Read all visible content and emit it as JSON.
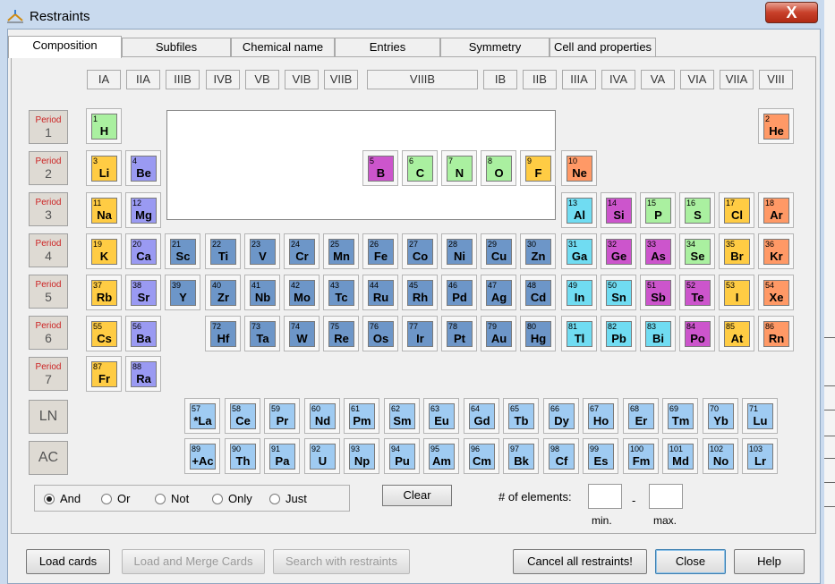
{
  "window": {
    "title": "Restraints",
    "close_glyph": "X"
  },
  "tabs": [
    {
      "label": "Composition",
      "active": true
    },
    {
      "label": "Subfiles",
      "active": false
    },
    {
      "label": "Chemical name",
      "active": false
    },
    {
      "label": "Entries",
      "active": false
    },
    {
      "label": "Symmetry",
      "active": false
    },
    {
      "label": "Cell and properties",
      "active": false
    }
  ],
  "groups": [
    "IA",
    "IIA",
    "IIIB",
    "IVB",
    "VB",
    "VIB",
    "VIIB",
    "VIIIB",
    "IB",
    "IIB",
    "IIIA",
    "IVA",
    "VA",
    "VIA",
    "VIIA",
    "VIII"
  ],
  "periods": [
    {
      "label": "Period",
      "num": "1"
    },
    {
      "label": "Period",
      "num": "2"
    },
    {
      "label": "Period",
      "num": "3"
    },
    {
      "label": "Period",
      "num": "4"
    },
    {
      "label": "Period",
      "num": "5"
    },
    {
      "label": "Period",
      "num": "6"
    },
    {
      "label": "Period",
      "num": "7"
    }
  ],
  "series_buttons": {
    "ln": "LN",
    "ac": "AC"
  },
  "colors": {
    "nonmetal": "#aaf0a0",
    "alkali": "#ffcc44",
    "alkaline": "#9a9af2",
    "transition": "#6d96c8",
    "poor": "#70dcf2",
    "metalloid": "#cc55cc",
    "halogen": "#ffcc44",
    "noble": "#ff9966",
    "rare": "#9fcbf2"
  },
  "elements": [
    {
      "num": "1",
      "sym": "H"
    },
    {
      "num": "2",
      "sym": "He"
    },
    {
      "num": "3",
      "sym": "Li"
    },
    {
      "num": "4",
      "sym": "Be"
    },
    {
      "num": "5",
      "sym": "B"
    },
    {
      "num": "6",
      "sym": "C"
    },
    {
      "num": "7",
      "sym": "N"
    },
    {
      "num": "8",
      "sym": "O"
    },
    {
      "num": "9",
      "sym": "F"
    },
    {
      "num": "10",
      "sym": "Ne"
    },
    {
      "num": "11",
      "sym": "Na"
    },
    {
      "num": "12",
      "sym": "Mg"
    },
    {
      "num": "13",
      "sym": "Al"
    },
    {
      "num": "14",
      "sym": "Si"
    },
    {
      "num": "15",
      "sym": "P"
    },
    {
      "num": "16",
      "sym": "S"
    },
    {
      "num": "17",
      "sym": "Cl"
    },
    {
      "num": "18",
      "sym": "Ar"
    },
    {
      "num": "19",
      "sym": "K"
    },
    {
      "num": "20",
      "sym": "Ca"
    },
    {
      "num": "21",
      "sym": "Sc"
    },
    {
      "num": "22",
      "sym": "Ti"
    },
    {
      "num": "23",
      "sym": "V"
    },
    {
      "num": "24",
      "sym": "Cr"
    },
    {
      "num": "25",
      "sym": "Mn"
    },
    {
      "num": "26",
      "sym": "Fe"
    },
    {
      "num": "27",
      "sym": "Co"
    },
    {
      "num": "28",
      "sym": "Ni"
    },
    {
      "num": "29",
      "sym": "Cu"
    },
    {
      "num": "30",
      "sym": "Zn"
    },
    {
      "num": "31",
      "sym": "Ga"
    },
    {
      "num": "32",
      "sym": "Ge"
    },
    {
      "num": "33",
      "sym": "As"
    },
    {
      "num": "34",
      "sym": "Se"
    },
    {
      "num": "35",
      "sym": "Br"
    },
    {
      "num": "36",
      "sym": "Kr"
    },
    {
      "num": "37",
      "sym": "Rb"
    },
    {
      "num": "38",
      "sym": "Sr"
    },
    {
      "num": "39",
      "sym": "Y"
    },
    {
      "num": "40",
      "sym": "Zr"
    },
    {
      "num": "41",
      "sym": "Nb"
    },
    {
      "num": "42",
      "sym": "Mo"
    },
    {
      "num": "43",
      "sym": "Tc"
    },
    {
      "num": "44",
      "sym": "Ru"
    },
    {
      "num": "45",
      "sym": "Rh"
    },
    {
      "num": "46",
      "sym": "Pd"
    },
    {
      "num": "47",
      "sym": "Ag"
    },
    {
      "num": "48",
      "sym": "Cd"
    },
    {
      "num": "49",
      "sym": "In"
    },
    {
      "num": "50",
      "sym": "Sn"
    },
    {
      "num": "51",
      "sym": "Sb"
    },
    {
      "num": "52",
      "sym": "Te"
    },
    {
      "num": "53",
      "sym": "I"
    },
    {
      "num": "54",
      "sym": "Xe"
    },
    {
      "num": "55",
      "sym": "Cs"
    },
    {
      "num": "56",
      "sym": "Ba"
    },
    {
      "num": "72",
      "sym": "Hf"
    },
    {
      "num": "73",
      "sym": "Ta"
    },
    {
      "num": "74",
      "sym": "W"
    },
    {
      "num": "75",
      "sym": "Re"
    },
    {
      "num": "76",
      "sym": "Os"
    },
    {
      "num": "77",
      "sym": "Ir"
    },
    {
      "num": "78",
      "sym": "Pt"
    },
    {
      "num": "79",
      "sym": "Au"
    },
    {
      "num": "80",
      "sym": "Hg"
    },
    {
      "num": "81",
      "sym": "Tl"
    },
    {
      "num": "82",
      "sym": "Pb"
    },
    {
      "num": "83",
      "sym": "Bi"
    },
    {
      "num": "84",
      "sym": "Po"
    },
    {
      "num": "85",
      "sym": "At"
    },
    {
      "num": "86",
      "sym": "Rn"
    },
    {
      "num": "87",
      "sym": "Fr"
    },
    {
      "num": "88",
      "sym": "Ra"
    },
    {
      "num": "57",
      "sym": "*La"
    },
    {
      "num": "58",
      "sym": "Ce"
    },
    {
      "num": "59",
      "sym": "Pr"
    },
    {
      "num": "60",
      "sym": "Nd"
    },
    {
      "num": "61",
      "sym": "Pm"
    },
    {
      "num": "62",
      "sym": "Sm"
    },
    {
      "num": "63",
      "sym": "Eu"
    },
    {
      "num": "64",
      "sym": "Gd"
    },
    {
      "num": "65",
      "sym": "Tb"
    },
    {
      "num": "66",
      "sym": "Dy"
    },
    {
      "num": "67",
      "sym": "Ho"
    },
    {
      "num": "68",
      "sym": "Er"
    },
    {
      "num": "69",
      "sym": "Tm"
    },
    {
      "num": "70",
      "sym": "Yb"
    },
    {
      "num": "71",
      "sym": "Lu"
    },
    {
      "num": "89",
      "sym": "+Ac"
    },
    {
      "num": "90",
      "sym": "Th"
    },
    {
      "num": "91",
      "sym": "Pa"
    },
    {
      "num": "92",
      "sym": "U"
    },
    {
      "num": "93",
      "sym": "Np"
    },
    {
      "num": "94",
      "sym": "Pu"
    },
    {
      "num": "95",
      "sym": "Am"
    },
    {
      "num": "96",
      "sym": "Cm"
    },
    {
      "num": "97",
      "sym": "Bk"
    },
    {
      "num": "98",
      "sym": "Cf"
    },
    {
      "num": "99",
      "sym": "Es"
    },
    {
      "num": "100",
      "sym": "Fm"
    },
    {
      "num": "101",
      "sym": "Md"
    },
    {
      "num": "102",
      "sym": "No"
    },
    {
      "num": "103",
      "sym": "Lr"
    }
  ],
  "logic": {
    "options": [
      {
        "label": "And",
        "selected": true
      },
      {
        "label": "Or",
        "selected": false
      },
      {
        "label": "Not",
        "selected": false
      },
      {
        "label": "Only",
        "selected": false
      },
      {
        "label": "Just",
        "selected": false
      }
    ]
  },
  "clear_label": "Clear",
  "count": {
    "label": "# of elements:",
    "dash": "-",
    "min_label": "min.",
    "max_label": "max."
  },
  "footer": {
    "load_cards": "Load cards",
    "load_merge": "Load and Merge Cards",
    "search": "Search with restraints",
    "cancel_all": "Cancel all restraints!",
    "close": "Close",
    "help": "Help"
  }
}
